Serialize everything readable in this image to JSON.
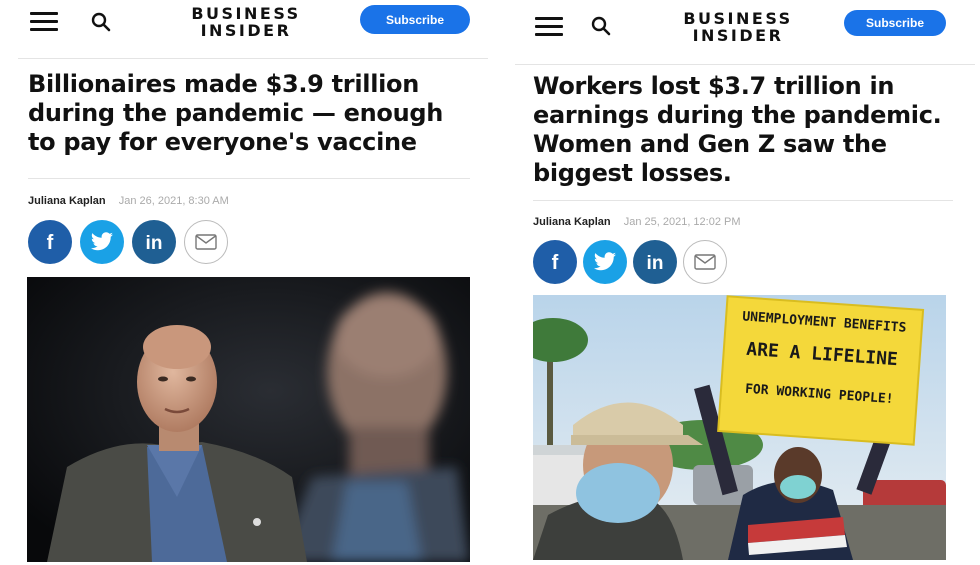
{
  "left": {
    "logo_line1": "BUSINESS",
    "logo_line2": "INSIDER",
    "subscribe_label": "Subscribe",
    "headline": "Billionaires made $3.9 trillion during the pandemic — enough to pay for everyone's vaccine",
    "author": "Juliana Kaplan",
    "date": "Jan 26, 2021, 8:30 AM"
  },
  "right": {
    "logo_line1": "BUSINESS",
    "logo_line2": "INSIDER",
    "subscribe_label": "Subscribe",
    "headline": "Workers lost $3.7 trillion in earnings during the pandemic. Women and Gen Z saw the biggest losses.",
    "author": "Juliana Kaplan",
    "date": "Jan 25, 2021, 12:02 PM",
    "sign_line1": "UNEMPLOYMENT BENEFITS",
    "sign_line2": "ARE A LIFELINE",
    "sign_line3": "FOR WORKING PEOPLE!"
  },
  "colors": {
    "subscribe": "#1a73e8",
    "facebook": "#1f5ea8",
    "twitter": "#1aa1e6",
    "linkedin": "#1f5f93"
  },
  "icons": [
    "menu-icon",
    "search-icon",
    "facebook-icon",
    "twitter-icon",
    "linkedin-icon",
    "email-icon"
  ]
}
